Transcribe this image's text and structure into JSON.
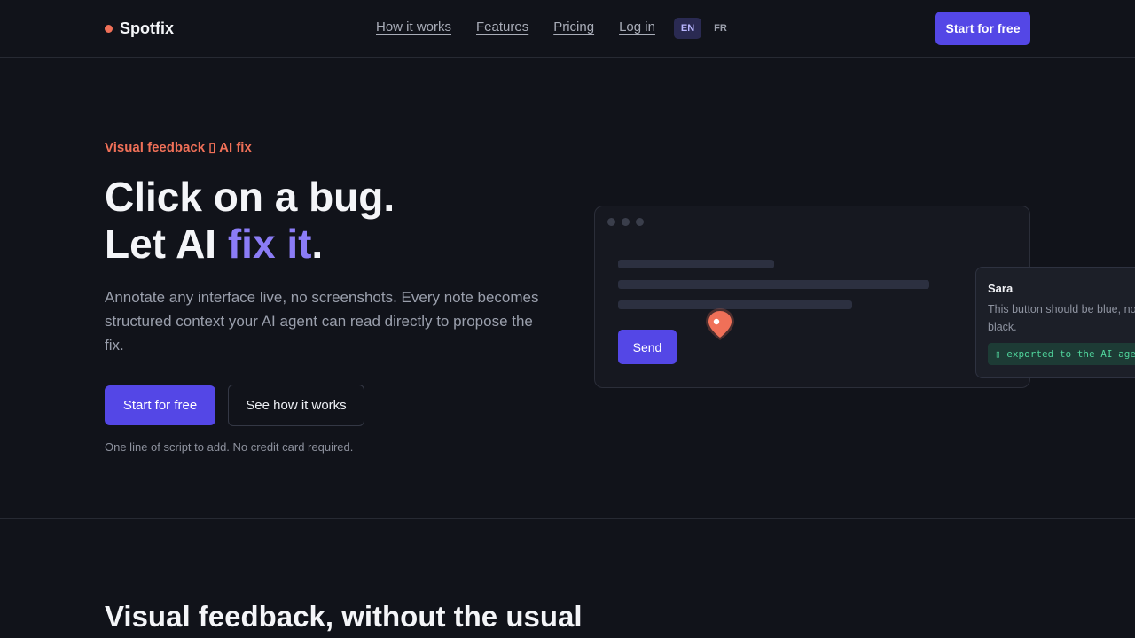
{
  "nav": {
    "brand": "Spotfix",
    "links": [
      "How it works",
      "Features",
      "Pricing",
      "Log in"
    ],
    "languages": [
      "EN",
      "FR"
    ],
    "active_language": "EN",
    "cta": "Start for free"
  },
  "hero": {
    "eyebrow": "Visual feedback ▯ AI fix",
    "headline_line1": "Click on a bug.",
    "headline_line2_prefix": "Let AI ",
    "headline_line2_accent": "fix it",
    "headline_line2_suffix": ".",
    "lead": "Annotate any interface live, no screenshots. Every note becomes structured context your AI agent can read directly to propose the fix.",
    "primary_cta": "Start for free",
    "secondary_cta": "See how it works",
    "note": "One line of script to add. No credit card required."
  },
  "mockup": {
    "send_label": "Send",
    "pin_icon": "map-pin-icon",
    "comment": {
      "author": "Sara",
      "text": "This button should be blue, not\nblack.",
      "tag": "▯ exported to the AI agent"
    }
  },
  "section2": {
    "title": "Visual feedback, without the usual"
  },
  "colors": {
    "background": "#11131a",
    "accent": "#5447e6",
    "accent_text": "#8b7cf6",
    "brand": "#f07058",
    "success": "#4fd29a"
  }
}
